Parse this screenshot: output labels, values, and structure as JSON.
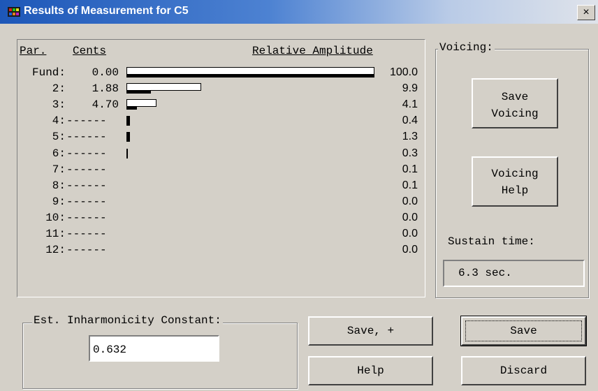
{
  "window": {
    "title": "Results of Measurement for C5",
    "close_label": "×"
  },
  "results": {
    "headers": {
      "partial": "Par.",
      "cents": "Cents",
      "amplitude": "Relative Amplitude"
    },
    "rows": [
      {
        "label": "Fund:",
        "cents": "0.00",
        "amp": "100.0",
        "white": 1.0,
        "black": 1.0
      },
      {
        "label": "2:",
        "cents": "1.88",
        "amp": "9.9",
        "white": 0.3,
        "black": 0.099
      },
      {
        "label": "3:",
        "cents": "4.70",
        "amp": "4.1",
        "white": 0.12,
        "black": 0.041
      },
      {
        "label": "4:",
        "cents": "------",
        "amp": "0.4",
        "white": 0,
        "black": 0.014
      },
      {
        "label": "5:",
        "cents": "------",
        "amp": "1.3",
        "white": 0,
        "black": 0.013
      },
      {
        "label": "6:",
        "cents": "------",
        "amp": "0.3",
        "white": 0,
        "black": 0.003
      },
      {
        "label": "7:",
        "cents": "------",
        "amp": "0.1",
        "white": 0,
        "black": 0
      },
      {
        "label": "8:",
        "cents": "------",
        "amp": "0.1",
        "white": 0,
        "black": 0
      },
      {
        "label": "9:",
        "cents": "------",
        "amp": "0.0",
        "white": 0,
        "black": 0
      },
      {
        "label": "10:",
        "cents": "------",
        "amp": "0.0",
        "white": 0,
        "black": 0
      },
      {
        "label": "11:",
        "cents": "------",
        "amp": "0.0",
        "white": 0,
        "black": 0
      },
      {
        "label": "12:",
        "cents": "------",
        "amp": "0.0",
        "white": 0,
        "black": 0
      }
    ]
  },
  "voicing": {
    "legend": "Voicing:",
    "save_voicing": [
      "Save",
      "Voicing"
    ],
    "voicing_help": [
      "Voicing",
      "Help"
    ],
    "sustain_label": "Sustain time:",
    "sustain_value": "6.3 sec."
  },
  "inharmonicity": {
    "legend": "Est. Inharmonicity Constant:",
    "value": "0.632"
  },
  "buttons": {
    "save_plus": "Save, +",
    "help": "Help",
    "save": "Save",
    "discard": "Discard"
  }
}
